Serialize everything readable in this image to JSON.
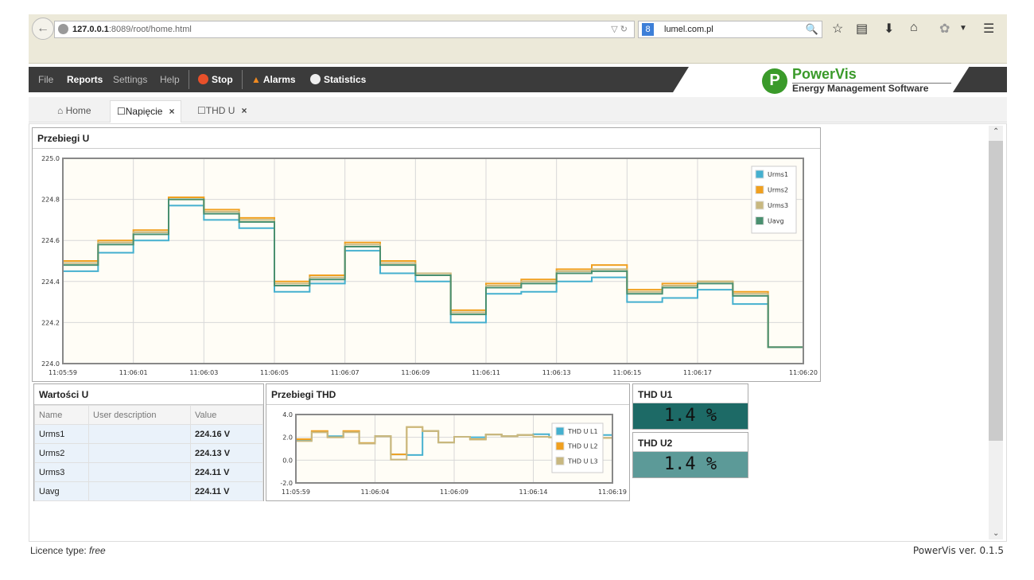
{
  "browser": {
    "url_host": "127.0.0.1",
    "url_rest": ":8089/root/home.html",
    "search": "lumel.com.pl",
    "search_engine_label": "8"
  },
  "menu": {
    "file": "File",
    "reports": "Reports",
    "settings": "Settings",
    "help": "Help",
    "stop": "Stop",
    "alarms": "Alarms",
    "statistics": "Statistics"
  },
  "brand": {
    "name": "PowerVis",
    "tagline": "Energy Management Software",
    "logo_letter": "P"
  },
  "tabs": [
    {
      "label": "Home"
    },
    {
      "label": "Napięcie"
    },
    {
      "label": "THD U"
    }
  ],
  "tab_close": "×",
  "panels": {
    "main_chart_title": "Przebiegi U",
    "values_title": "Wartości U",
    "thd_chart_title": "Przebiegi THD"
  },
  "values_table": {
    "headers": [
      "Name",
      "User description",
      "Value"
    ],
    "rows": [
      {
        "name": "Urms1",
        "desc": "",
        "value": "224.16 V"
      },
      {
        "name": "Urms2",
        "desc": "",
        "value": "224.13 V"
      },
      {
        "name": "Urms3",
        "desc": "",
        "value": "224.11 V"
      },
      {
        "name": "Uavg",
        "desc": "",
        "value": "224.11 V"
      }
    ]
  },
  "tiles": [
    {
      "title": "THD U1",
      "value": "1.4 %",
      "color": "#1d6a66"
    },
    {
      "title": "THD U2",
      "value": "1.4 %",
      "color": "#5c9a98"
    }
  ],
  "footer": {
    "licence_label": "Licence type: ",
    "licence_value": "free",
    "version": "PowerVis ver. 0.1.5"
  },
  "chart_data": [
    {
      "type": "line",
      "step": true,
      "title": "",
      "ylim": [
        224.0,
        225.0
      ],
      "yticks": [
        "225.0",
        "224.8",
        "224.6",
        "224.4",
        "224.2",
        "224.0"
      ],
      "xticks": [
        "11:05:59",
        "11:06:01",
        "11:06:03",
        "11:06:05",
        "11:06:07",
        "11:06:09",
        "11:06:11",
        "11:06:13",
        "11:06:15",
        "11:06:17",
        "11:06:20"
      ],
      "x": [
        "11:05:59",
        "11:06:00",
        "11:06:01",
        "11:06:02",
        "11:06:03",
        "11:06:04",
        "11:06:05",
        "11:06:06",
        "11:06:07",
        "11:06:08",
        "11:06:09",
        "11:06:10",
        "11:06:11",
        "11:06:12",
        "11:06:13",
        "11:06:14",
        "11:06:15",
        "11:06:16",
        "11:06:17",
        "11:06:18",
        "11:06:19",
        "11:06:20"
      ],
      "grid": true,
      "legend": "top-right",
      "series": [
        {
          "name": "Urms1",
          "color": "#45b0cf",
          "values": [
            224.45,
            224.54,
            224.6,
            224.77,
            224.7,
            224.66,
            224.35,
            224.39,
            224.55,
            224.44,
            224.4,
            224.2,
            224.34,
            224.35,
            224.4,
            224.42,
            224.3,
            224.32,
            224.36,
            224.29,
            224.08,
            224.08
          ]
        },
        {
          "name": "Urms2",
          "color": "#f0a020",
          "values": [
            224.5,
            224.6,
            224.65,
            224.81,
            224.75,
            224.71,
            224.4,
            224.43,
            224.59,
            224.5,
            224.44,
            224.26,
            224.39,
            224.41,
            224.46,
            224.48,
            224.36,
            224.39,
            224.4,
            224.35,
            224.08,
            224.08
          ]
        },
        {
          "name": "Urms3",
          "color": "#c8b880",
          "values": [
            224.49,
            224.59,
            224.64,
            224.8,
            224.74,
            224.7,
            224.39,
            224.42,
            224.58,
            224.49,
            224.44,
            224.25,
            224.38,
            224.4,
            224.45,
            224.46,
            224.35,
            224.38,
            224.4,
            224.34,
            224.08,
            224.08
          ]
        },
        {
          "name": "Uavg",
          "color": "#4a9070",
          "values": [
            224.48,
            224.58,
            224.63,
            224.8,
            224.73,
            224.69,
            224.38,
            224.41,
            224.57,
            224.48,
            224.43,
            224.24,
            224.37,
            224.39,
            224.44,
            224.45,
            224.34,
            224.37,
            224.39,
            224.33,
            224.08,
            224.08
          ]
        }
      ]
    },
    {
      "type": "line",
      "step": true,
      "title": "",
      "ylim": [
        -2.0,
        4.0
      ],
      "yticks": [
        "4.0",
        "2.0",
        "0.0",
        "-2.0"
      ],
      "xticks": [
        "11:05:59",
        "11:06:04",
        "11:06:09",
        "11:06:14",
        "11:06:19"
      ],
      "x": [
        "11:05:59",
        "11:06:00",
        "11:06:01",
        "11:06:02",
        "11:06:03",
        "11:06:04",
        "11:06:05",
        "11:06:06",
        "11:06:07",
        "11:06:08",
        "11:06:09",
        "11:06:10",
        "11:06:11",
        "11:06:12",
        "11:06:13",
        "11:06:14",
        "11:06:15",
        "11:06:16",
        "11:06:17",
        "11:06:18",
        "11:06:19"
      ],
      "grid": true,
      "legend": "right",
      "series": [
        {
          "name": "THD U L1",
          "color": "#45b0cf",
          "values": [
            1.8,
            2.5,
            2.1,
            2.5,
            1.5,
            2.1,
            0.5,
            0.45,
            2.55,
            1.55,
            2.05,
            2.0,
            2.25,
            2.1,
            2.2,
            2.27,
            2.0,
            2.0,
            2.0,
            2.2,
            2.2
          ]
        },
        {
          "name": "THD U L2",
          "color": "#f0a020",
          "values": [
            1.84,
            2.55,
            2.0,
            2.55,
            1.5,
            2.1,
            0.5,
            2.9,
            2.55,
            1.55,
            2.05,
            1.84,
            2.25,
            2.1,
            2.2,
            2.05,
            2.0,
            2.0,
            2.0,
            1.95,
            1.95
          ]
        },
        {
          "name": "THD U L3",
          "color": "#c8b880",
          "values": [
            1.67,
            2.44,
            2.0,
            2.45,
            1.45,
            2.1,
            0.05,
            2.9,
            2.55,
            1.55,
            2.05,
            1.8,
            2.25,
            2.1,
            2.2,
            2.05,
            2.0,
            2.0,
            2.2,
            1.95,
            1.95
          ]
        }
      ]
    }
  ]
}
